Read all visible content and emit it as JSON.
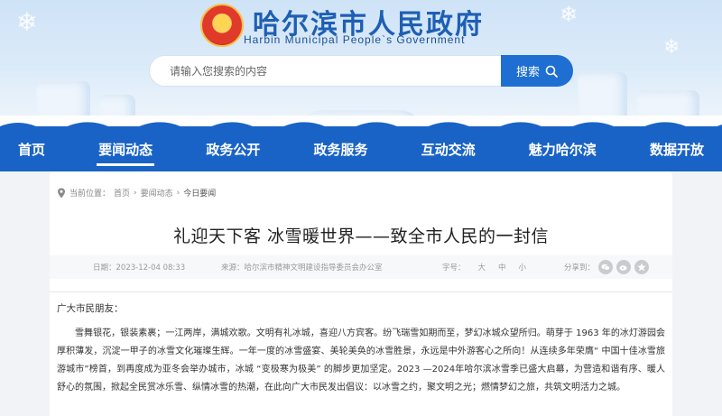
{
  "header": {
    "site_title": "哈尔滨市人民政府",
    "site_subtitle": "Harbin Municipal People`s Government",
    "search_placeholder": "请输入您搜索的内容",
    "search_button": "搜索"
  },
  "nav": {
    "items": [
      {
        "label": "首页"
      },
      {
        "label": "要闻动态"
      },
      {
        "label": "政务公开"
      },
      {
        "label": "政务服务"
      },
      {
        "label": "互动交流"
      },
      {
        "label": "魅力哈尔滨"
      },
      {
        "label": "数据开放"
      }
    ],
    "active_index": 1
  },
  "breadcrumb": {
    "prefix": "当前位置：",
    "items": [
      "首页",
      "要闻动态",
      "今日要闻"
    ],
    "separator": "›"
  },
  "article": {
    "title": "礼迎天下客 冰雪暖世界——致全市人民的一封信",
    "date": "日期：2023-12-04 08:33",
    "source": "来源：哈尔滨市精神文明建设指导委员会办公室",
    "font_size_label": "字号：",
    "font_sizes": [
      "大",
      "中",
      "小"
    ],
    "share_label": "分享到：",
    "share_icons": [
      "wechat-icon",
      "weibo-icon",
      "qzone-icon"
    ],
    "greeting": "广大市民朋友：",
    "paragraph": "雪舞银花，银装素裹；一江两岸，满城欢歌。文明有礼冰城，喜迎八方宾客。纷飞瑞雪如期而至，梦幻冰城众望所归。萌芽于 1963 年的冰灯游园会厚积薄发，沉淀一甲子的冰雪文化璀璨生辉。一年一度的冰雪盛宴、美轮美奂的冰雪胜景，永远是中外游客心之所向！从连续多年荣膺“ 中国十佳冰雪旅游城市”榜首，到再度成为亚冬会举办城市，冰城 “变极寒为极美” 的脚步更加坚定。2023 —2024年哈尔滨冰雪季已盛大启幕，为营造和谐有序、暖人舒心的氛围，掀起全民赏冰乐雪、纵情冰雪的热潮，在此向广大市民发出倡议：以冰雪之约，聚文明之光；燃情梦幻之旅，共筑文明活力之城。"
  },
  "colors": {
    "nav_blue": "#1a63c6",
    "title_blue": "#1e5fb4",
    "search_button": "#1e6fd1"
  }
}
